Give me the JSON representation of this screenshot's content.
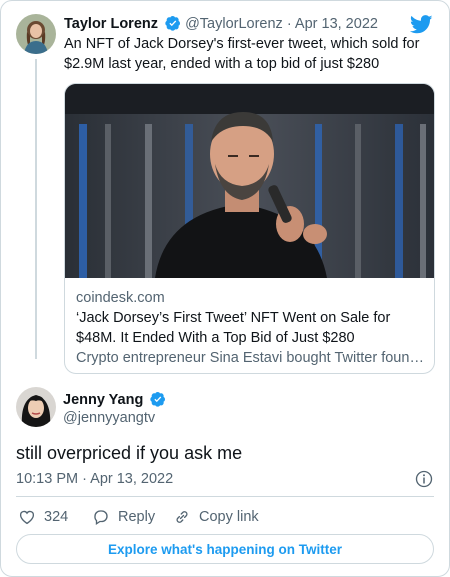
{
  "parent_tweet": {
    "author_name": "Taylor Lorenz",
    "author_handle": "@TaylorLorenz",
    "separator": "·",
    "date": "Apr 13, 2022",
    "text": "An NFT of Jack Dorsey's first-ever tweet, which sold for $2.9M last year, ended with a top bid of just $280",
    "link_card": {
      "domain": "coindesk.com",
      "title": "‘Jack Dorsey’s First Tweet’ NFT Went on Sale for $48M. It Ended With a Top Bid of Just $280",
      "description": "Crypto entrepreneur Sina Estavi bought Twitter founde..."
    }
  },
  "reply_tweet": {
    "author_name": "Jenny Yang",
    "author_handle": "@jennyyangtv",
    "text": "still overpriced if you ask me",
    "timestamp": "10:13 PM · Apr 13, 2022"
  },
  "actions": {
    "like_count": "324",
    "reply_label": "Reply",
    "copy_link_label": "Copy link"
  },
  "footer": {
    "explore_label": "Explore what's happening on Twitter"
  },
  "icons": {
    "brand": "twitter-bird-icon",
    "verified": "verified-badge-icon",
    "info": "info-icon",
    "like": "heart-icon",
    "reply": "speech-bubble-icon",
    "copy_link": "link-icon"
  },
  "colors": {
    "accent": "#1d9bf0",
    "text_primary": "#0f1419",
    "text_secondary": "#536471",
    "border": "#cfd9de"
  }
}
